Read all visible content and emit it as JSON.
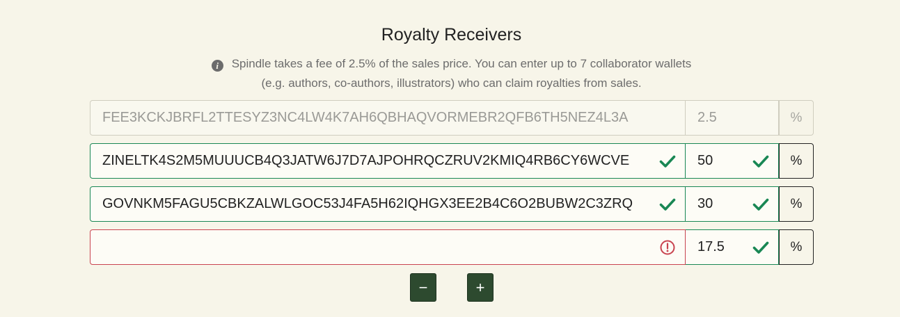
{
  "title": "Royalty Receivers",
  "info": {
    "icon": "info-circle-icon",
    "line1": "Spindle takes a fee of 2.5% of the sales price. You can enter up to 7 collaborator wallets",
    "line2": "(e.g. authors, co-authors, illustrators) who can claim royalties from sales."
  },
  "rows": [
    {
      "address": "FEE3KCKJBRFL2TTESYZ3NC4LW4K7AH6QBHAQVORMEBR2QFB6TH5NEZ4L3A",
      "percent": "2.5",
      "unit": "%",
      "state": "disabled"
    },
    {
      "address": "ZINELTK4S2M5MUUUCB4Q3JATW6J7D7AJPOHRQCZRUV2KMIQ4RB6CY6WCVE",
      "percent": "50",
      "unit": "%",
      "state": "valid"
    },
    {
      "address": "GOVNKM5FAGU5CBKZALWLGOC53J4FA5H62IQHGX3EE2B4C6O2BUBW2C3ZRQ",
      "percent": "30",
      "unit": "%",
      "state": "valid"
    },
    {
      "address": "",
      "percent": "17.5",
      "unit": "%",
      "state": "invalid-address"
    }
  ],
  "buttons": {
    "remove_label": "−",
    "add_label": "+"
  },
  "colors": {
    "background": "#f7f5e9",
    "valid": "#198754",
    "invalid": "#c8434f",
    "button": "#2d4a2f"
  }
}
